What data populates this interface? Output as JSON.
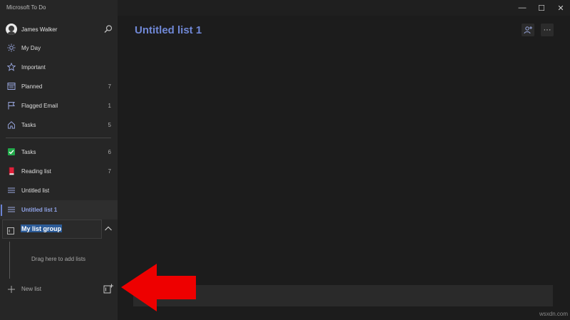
{
  "window": {
    "title": "Microsoft To Do",
    "minimize_glyph": "—",
    "maximize_glyph": "☐",
    "close_glyph": "✕"
  },
  "user": {
    "name": "James Walker"
  },
  "smart_lists": [
    {
      "label": "My Day",
      "count": "",
      "icon": "sun-icon"
    },
    {
      "label": "Important",
      "count": "",
      "icon": "star-icon"
    },
    {
      "label": "Planned",
      "count": "7",
      "icon": "calendar-icon"
    },
    {
      "label": "Flagged Email",
      "count": "1",
      "icon": "flag-icon"
    },
    {
      "label": "Tasks",
      "count": "5",
      "icon": "home-icon"
    }
  ],
  "lists": [
    {
      "label": "Tasks",
      "count": "6",
      "icon": "green-checkbox-icon"
    },
    {
      "label": "Reading list",
      "count": "7",
      "icon": "red-book-icon"
    },
    {
      "label": "Untitled list",
      "count": "",
      "icon": "list-lines-icon"
    },
    {
      "label": "Untitled list 1",
      "count": "",
      "icon": "list-lines-icon",
      "selected": true
    }
  ],
  "group": {
    "name": "My list group",
    "drag_hint": "Drag here to add lists"
  },
  "new_list": {
    "label": "New list"
  },
  "main": {
    "title": "Untitled list 1",
    "more_glyph": "···"
  },
  "watermark": "wsxdn.com",
  "colors": {
    "accent": "#7088d6",
    "arrow": "#ee0000",
    "selection": "#2c5b97"
  }
}
